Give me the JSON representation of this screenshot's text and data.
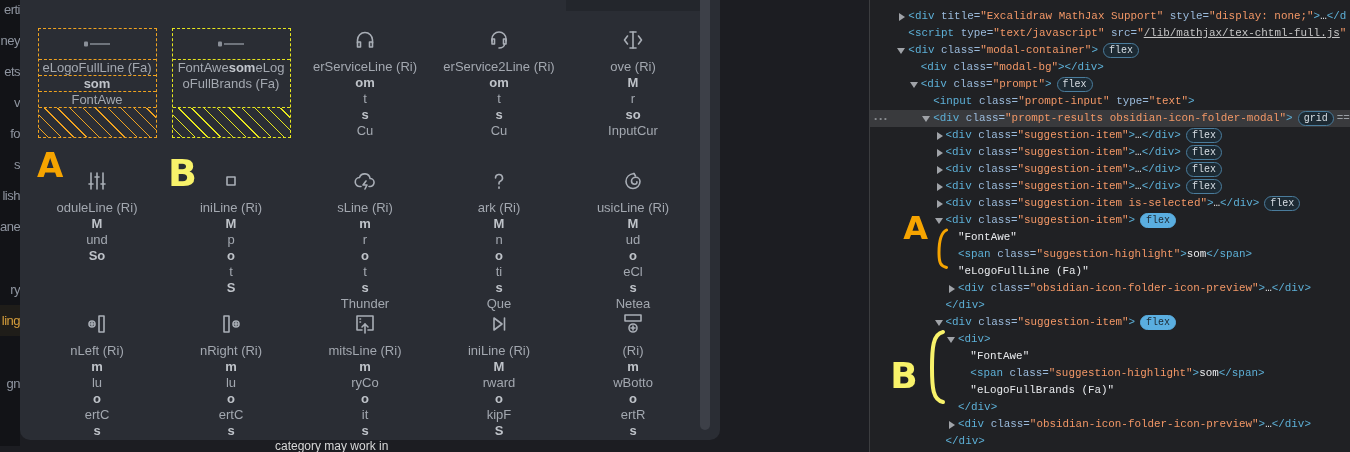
{
  "sidebar": {
    "groups": [
      [
        {
          "label": "erti",
          "selected": false
        },
        {
          "label": "ney",
          "selected": false
        },
        {
          "label": "ets",
          "selected": false
        },
        {
          "label": "v",
          "selected": false
        },
        {
          "label": "fo",
          "selected": false
        },
        {
          "label": "s",
          "selected": false
        },
        {
          "label": "lish",
          "selected": false
        },
        {
          "label": "ane",
          "selected": false
        }
      ],
      [
        {
          "label": "ry",
          "selected": false
        },
        {
          "label": "ling",
          "selected": true
        }
      ],
      [
        {
          "label": "gn",
          "selected": false
        }
      ]
    ]
  },
  "modal": {
    "items": [
      {
        "kind": "flex-overlay",
        "color": "#f0a320",
        "parts": [
          {
            "text": "eLogoFullLine (Fa)",
            "highlight": false
          },
          {
            "text": "som",
            "highlight": true
          },
          {
            "text": "FontAwe",
            "highlight": false
          }
        ]
      },
      {
        "kind": "wrap-overlay",
        "color": "#e6e61e",
        "text": "FontAwe**som**eLogoFullBrands (Fa)"
      },
      {
        "kind": "icon",
        "parts": [
          {
            "text": "erServiceLine (Ri)",
            "highlight": false
          },
          {
            "text": "om",
            "highlight": true
          },
          {
            "text": "t",
            "highlight": false
          },
          {
            "text": "s",
            "highlight": true
          },
          {
            "text": "Cu",
            "highlight": false
          }
        ]
      },
      {
        "kind": "icon",
        "parts": [
          {
            "text": "erService2Line (Ri)",
            "highlight": false
          },
          {
            "text": "om",
            "highlight": true
          },
          {
            "text": "t",
            "highlight": false
          },
          {
            "text": "s",
            "highlight": true
          },
          {
            "text": "Cu",
            "highlight": false
          }
        ]
      },
      {
        "kind": "icon",
        "parts": [
          {
            "text": "ove (Ri)",
            "highlight": false
          },
          {
            "text": "M",
            "highlight": true
          },
          {
            "text": "r",
            "highlight": false
          },
          {
            "text": "so",
            "highlight": true
          },
          {
            "text": "InputCur",
            "highlight": false
          }
        ]
      },
      {
        "kind": "icon",
        "parts": [
          {
            "text": "oduleLine (Ri)",
            "highlight": false
          },
          {
            "text": "M",
            "highlight": true
          },
          {
            "text": "und",
            "highlight": false
          },
          {
            "text": "So",
            "highlight": true
          }
        ]
      },
      {
        "kind": "icon",
        "parts": [
          {
            "text": "iniLine (Ri)",
            "highlight": false
          },
          {
            "text": "M",
            "highlight": true
          },
          {
            "text": "p",
            "highlight": false
          },
          {
            "text": "o",
            "highlight": true
          },
          {
            "text": "t",
            "highlight": false
          },
          {
            "text": "S",
            "highlight": true
          }
        ]
      },
      {
        "kind": "icon",
        "parts": [
          {
            "text": "sLine (Ri)",
            "highlight": false
          },
          {
            "text": "m",
            "highlight": true
          },
          {
            "text": "r",
            "highlight": false
          },
          {
            "text": "o",
            "highlight": true
          },
          {
            "text": "t",
            "highlight": false
          },
          {
            "text": "s",
            "highlight": true
          },
          {
            "text": "Thunder",
            "highlight": false
          }
        ]
      },
      {
        "kind": "icon",
        "parts": [
          {
            "text": "ark (Ri)",
            "highlight": false
          },
          {
            "text": "M",
            "highlight": true
          },
          {
            "text": "n",
            "highlight": false
          },
          {
            "text": "o",
            "highlight": true
          },
          {
            "text": "ti",
            "highlight": false
          },
          {
            "text": "s",
            "highlight": true
          },
          {
            "text": "Que",
            "highlight": false
          }
        ]
      },
      {
        "kind": "icon",
        "parts": [
          {
            "text": "usicLine (Ri)",
            "highlight": false
          },
          {
            "text": "M",
            "highlight": true
          },
          {
            "text": "ud",
            "highlight": false
          },
          {
            "text": "o",
            "highlight": true
          },
          {
            "text": "eCl",
            "highlight": false
          },
          {
            "text": "s",
            "highlight": true
          },
          {
            "text": "Netea",
            "highlight": false
          }
        ]
      },
      {
        "kind": "icon",
        "parts": [
          {
            "text": "nLeft (Ri)",
            "highlight": false
          },
          {
            "text": "m",
            "highlight": true
          },
          {
            "text": "lu",
            "highlight": false
          },
          {
            "text": "o",
            "highlight": true
          },
          {
            "text": "ertC",
            "highlight": false
          },
          {
            "text": "s",
            "highlight": true
          }
        ]
      },
      {
        "kind": "icon",
        "parts": [
          {
            "text": "nRight (Ri)",
            "highlight": false
          },
          {
            "text": "m",
            "highlight": true
          },
          {
            "text": "lu",
            "highlight": false
          },
          {
            "text": "o",
            "highlight": true
          },
          {
            "text": "ertC",
            "highlight": false
          },
          {
            "text": "s",
            "highlight": true
          }
        ]
      },
      {
        "kind": "icon",
        "parts": [
          {
            "text": "mitsLine (Ri)",
            "highlight": false
          },
          {
            "text": "m",
            "highlight": true
          },
          {
            "text": "ryCo",
            "highlight": false
          },
          {
            "text": "o",
            "highlight": true
          },
          {
            "text": "it",
            "highlight": false
          },
          {
            "text": "s",
            "highlight": true
          }
        ]
      },
      {
        "kind": "icon",
        "parts": [
          {
            "text": "iniLine (Ri)",
            "highlight": false
          },
          {
            "text": "M",
            "highlight": true
          },
          {
            "text": "rward",
            "highlight": false
          },
          {
            "text": "o",
            "highlight": true
          },
          {
            "text": "kipF",
            "highlight": false
          },
          {
            "text": "S",
            "highlight": true
          }
        ]
      },
      {
        "kind": "icon",
        "parts": [
          {
            "text": "(Ri)",
            "highlight": false
          },
          {
            "text": "m",
            "highlight": true
          },
          {
            "text": "wBotto",
            "highlight": false
          },
          {
            "text": "o",
            "highlight": true
          },
          {
            "text": "ertR",
            "highlight": false
          },
          {
            "text": "s",
            "highlight": true
          }
        ]
      }
    ],
    "annotations": [
      {
        "label": "A",
        "color": "#f6a400"
      },
      {
        "label": "B",
        "color": "#f8f26a"
      }
    ]
  },
  "background_text": "category may work in",
  "devtools": {
    "nodes": [
      {
        "selected": false,
        "expanded": false,
        "tokens": [
          {
            "kind": "tag",
            "text": "<div"
          },
          {
            "kind": "attr",
            "text": " title="
          },
          {
            "kind": "value",
            "text": "\"Excalidraw MathJax Support\""
          },
          {
            "kind": "attr",
            "text": " style="
          },
          {
            "kind": "value",
            "text": "\"display: none;\""
          },
          {
            "kind": "tag",
            "text": ">"
          },
          {
            "kind": "plain",
            "text": "…"
          },
          {
            "kind": "tag",
            "text": "</d"
          }
        ]
      },
      {
        "selected": false,
        "tokens": [
          {
            "kind": "tag",
            "text": "<script"
          },
          {
            "kind": "attr",
            "text": " type="
          },
          {
            "kind": "value",
            "text": "\"text/javascript\""
          },
          {
            "kind": "attr",
            "text": " src="
          },
          {
            "kind": "value",
            "text": "\""
          },
          {
            "kind": "link",
            "text": "/lib/mathjax/tex-chtml-full.js"
          },
          {
            "kind": "value",
            "text": "\""
          }
        ]
      },
      {
        "selected": false,
        "expanded": true,
        "tokens": [
          {
            "kind": "tag",
            "text": "<div"
          },
          {
            "kind": "attr",
            "text": " class="
          },
          {
            "kind": "value",
            "text": "\"modal-container\""
          },
          {
            "kind": "tag",
            "text": ">"
          }
        ],
        "badge": {
          "label": "flex",
          "active": false
        },
        "children": [
          {
            "selected": false,
            "tokens": [
              {
                "kind": "tag",
                "text": "<div"
              },
              {
                "kind": "attr",
                "text": " class="
              },
              {
                "kind": "value",
                "text": "\"modal-bg\""
              },
              {
                "kind": "tag",
                "text": "></div>"
              }
            ]
          },
          {
            "selected": false,
            "expanded": true,
            "tokens": [
              {
                "kind": "tag",
                "text": "<div"
              },
              {
                "kind": "attr",
                "text": " class="
              },
              {
                "kind": "value",
                "text": "\"prompt\""
              },
              {
                "kind": "tag",
                "text": ">"
              }
            ],
            "badge": {
              "label": "flex",
              "active": false
            },
            "children": [
              {
                "selected": false,
                "tokens": [
                  {
                    "kind": "tag",
                    "text": "<input"
                  },
                  {
                    "kind": "attr",
                    "text": " class="
                  },
                  {
                    "kind": "value",
                    "text": "\"prompt-input\""
                  },
                  {
                    "kind": "attr",
                    "text": " type="
                  },
                  {
                    "kind": "value",
                    "text": "\"text\""
                  },
                  {
                    "kind": "tag",
                    "text": ">"
                  }
                ]
              },
              {
                "selected": true,
                "gutter": "•••",
                "expanded": true,
                "tokens": [
                  {
                    "kind": "tag",
                    "text": "<div"
                  },
                  {
                    "kind": "attr",
                    "text": " class="
                  },
                  {
                    "kind": "value",
                    "text": "\"prompt-results obsidian-icon-folder-modal\""
                  },
                  {
                    "kind": "tag",
                    "text": ">"
                  }
                ],
                "badge": {
                  "label": "grid",
                  "active": false
                },
                "after": "==",
                "children": [
                  {
                    "selected": false,
                    "expanded": false,
                    "tokens": [
                      {
                        "kind": "tag",
                        "text": "<div"
                      },
                      {
                        "kind": "attr",
                        "text": " class="
                      },
                      {
                        "kind": "value",
                        "text": "\"suggestion-item\""
                      },
                      {
                        "kind": "tag",
                        "text": ">"
                      },
                      {
                        "kind": "plain",
                        "text": "…"
                      },
                      {
                        "kind": "tag",
                        "text": "</div>"
                      }
                    ],
                    "badge": {
                      "label": "flex",
                      "active": false
                    }
                  },
                  {
                    "selected": false,
                    "expanded": false,
                    "tokens": [
                      {
                        "kind": "tag",
                        "text": "<div"
                      },
                      {
                        "kind": "attr",
                        "text": " class="
                      },
                      {
                        "kind": "value",
                        "text": "\"suggestion-item\""
                      },
                      {
                        "kind": "tag",
                        "text": ">"
                      },
                      {
                        "kind": "plain",
                        "text": "…"
                      },
                      {
                        "kind": "tag",
                        "text": "</div>"
                      }
                    ],
                    "badge": {
                      "label": "flex",
                      "active": false
                    }
                  },
                  {
                    "selected": false,
                    "expanded": false,
                    "tokens": [
                      {
                        "kind": "tag",
                        "text": "<div"
                      },
                      {
                        "kind": "attr",
                        "text": " class="
                      },
                      {
                        "kind": "value",
                        "text": "\"suggestion-item\""
                      },
                      {
                        "kind": "tag",
                        "text": ">"
                      },
                      {
                        "kind": "plain",
                        "text": "…"
                      },
                      {
                        "kind": "tag",
                        "text": "</div>"
                      }
                    ],
                    "badge": {
                      "label": "flex",
                      "active": false
                    }
                  },
                  {
                    "selected": false,
                    "expanded": false,
                    "tokens": [
                      {
                        "kind": "tag",
                        "text": "<div"
                      },
                      {
                        "kind": "attr",
                        "text": " class="
                      },
                      {
                        "kind": "value",
                        "text": "\"suggestion-item\""
                      },
                      {
                        "kind": "tag",
                        "text": ">"
                      },
                      {
                        "kind": "plain",
                        "text": "…"
                      },
                      {
                        "kind": "tag",
                        "text": "</div>"
                      }
                    ],
                    "badge": {
                      "label": "flex",
                      "active": false
                    }
                  },
                  {
                    "selected": false,
                    "expanded": false,
                    "tokens": [
                      {
                        "kind": "tag",
                        "text": "<div"
                      },
                      {
                        "kind": "attr",
                        "text": " class="
                      },
                      {
                        "kind": "value",
                        "text": "\"suggestion-item is-selected\""
                      },
                      {
                        "kind": "tag",
                        "text": ">"
                      },
                      {
                        "kind": "plain",
                        "text": "…"
                      },
                      {
                        "kind": "tag",
                        "text": "</div>"
                      }
                    ],
                    "badge": {
                      "label": "flex",
                      "active": false
                    }
                  },
                  {
                    "selected": false,
                    "expanded": true,
                    "tokens": [
                      {
                        "kind": "tag",
                        "text": "<div"
                      },
                      {
                        "kind": "attr",
                        "text": " class="
                      },
                      {
                        "kind": "value",
                        "text": "\"suggestion-item\""
                      },
                      {
                        "kind": "tag",
                        "text": ">"
                      }
                    ],
                    "badge": {
                      "label": "flex",
                      "active": true
                    },
                    "close": [
                      {
                        "kind": "tag",
                        "text": "</div>"
                      }
                    ],
                    "children": [
                      {
                        "selected": false,
                        "tokens": [
                          {
                            "kind": "plain",
                            "text": "\"FontAwe\""
                          }
                        ]
                      },
                      {
                        "selected": false,
                        "tokens": [
                          {
                            "kind": "tag",
                            "text": "<span"
                          },
                          {
                            "kind": "attr",
                            "text": " class="
                          },
                          {
                            "kind": "value",
                            "text": "\"suggestion-highlight\""
                          },
                          {
                            "kind": "tag",
                            "text": ">"
                          },
                          {
                            "kind": "plain",
                            "text": "som"
                          },
                          {
                            "kind": "tag",
                            "text": "</span>"
                          }
                        ]
                      },
                      {
                        "selected": false,
                        "tokens": [
                          {
                            "kind": "plain",
                            "text": "\"eLogoFullLine (Fa)\""
                          }
                        ]
                      },
                      {
                        "selected": false,
                        "expanded": false,
                        "tokens": [
                          {
                            "kind": "tag",
                            "text": "<div"
                          },
                          {
                            "kind": "attr",
                            "text": " class="
                          },
                          {
                            "kind": "value",
                            "text": "\"obsidian-icon-folder-icon-preview\""
                          },
                          {
                            "kind": "tag",
                            "text": ">"
                          },
                          {
                            "kind": "plain",
                            "text": "…"
                          },
                          {
                            "kind": "tag",
                            "text": "</div>"
                          }
                        ]
                      }
                    ]
                  },
                  {
                    "selected": false,
                    "expanded": true,
                    "tokens": [
                      {
                        "kind": "tag",
                        "text": "<div"
                      },
                      {
                        "kind": "attr",
                        "text": " class="
                      },
                      {
                        "kind": "value",
                        "text": "\"suggestion-item\""
                      },
                      {
                        "kind": "tag",
                        "text": ">"
                      }
                    ],
                    "badge": {
                      "label": "flex",
                      "active": true
                    },
                    "close": [
                      {
                        "kind": "tag",
                        "text": "</div>"
                      }
                    ],
                    "children": [
                      {
                        "selected": false,
                        "expanded": true,
                        "tokens": [
                          {
                            "kind": "tag",
                            "text": "<div>"
                          }
                        ],
                        "close": [
                          {
                            "kind": "tag",
                            "text": "</div>"
                          }
                        ],
                        "children": [
                          {
                            "selected": false,
                            "tokens": [
                              {
                                "kind": "plain",
                                "text": "\"FontAwe\""
                              }
                            ]
                          },
                          {
                            "selected": false,
                            "tokens": [
                              {
                                "kind": "tag",
                                "text": "<span"
                              },
                              {
                                "kind": "attr",
                                "text": " class="
                              },
                              {
                                "kind": "value",
                                "text": "\"suggestion-highlight\""
                              },
                              {
                                "kind": "tag",
                                "text": ">"
                              },
                              {
                                "kind": "plain",
                                "text": "som"
                              },
                              {
                                "kind": "tag",
                                "text": "</span>"
                              }
                            ]
                          },
                          {
                            "selected": false,
                            "tokens": [
                              {
                                "kind": "plain",
                                "text": "\"eLogoFullBrands (Fa)\""
                              }
                            ]
                          }
                        ]
                      },
                      {
                        "selected": false,
                        "expanded": false,
                        "tokens": [
                          {
                            "kind": "tag",
                            "text": "<div"
                          },
                          {
                            "kind": "attr",
                            "text": " class="
                          },
                          {
                            "kind": "value",
                            "text": "\"obsidian-icon-folder-icon-preview\""
                          },
                          {
                            "kind": "tag",
                            "text": ">"
                          },
                          {
                            "kind": "plain",
                            "text": "…"
                          },
                          {
                            "kind": "tag",
                            "text": "</div>"
                          }
                        ]
                      }
                    ]
                  }
                ]
              }
            ]
          }
        ]
      }
    ],
    "annotations": [
      {
        "label": "A",
        "color": "#f6a400"
      },
      {
        "label": "B",
        "color": "#f8f26a"
      }
    ]
  }
}
